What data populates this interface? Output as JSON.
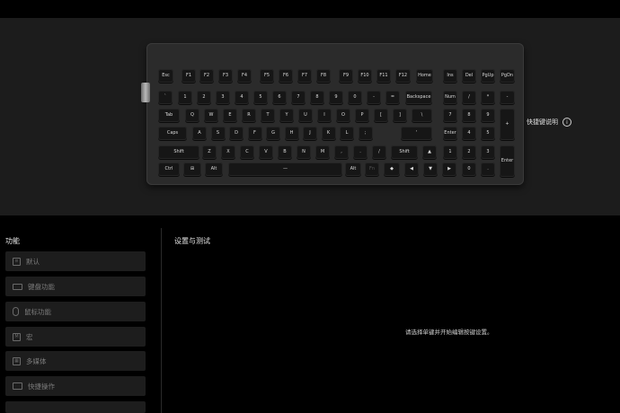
{
  "keyboard": {
    "rows": [
      [
        {
          "id": "esc",
          "label": "Esc"
        },
        {
          "id": "f1",
          "label": "F1"
        },
        {
          "id": "f2",
          "label": "F2"
        },
        {
          "id": "f3",
          "label": "F3"
        },
        {
          "id": "f4",
          "label": "F4"
        },
        {
          "id": "f5",
          "label": "F5"
        },
        {
          "id": "f6",
          "label": "F6"
        },
        {
          "id": "f7",
          "label": "F7"
        },
        {
          "id": "f8",
          "label": "F8"
        },
        {
          "id": "f9",
          "label": "F9"
        },
        {
          "id": "f10",
          "label": "F10"
        },
        {
          "id": "f11",
          "label": "F11"
        },
        {
          "id": "f12",
          "label": "F12"
        },
        {
          "id": "home",
          "label": "Home"
        },
        {
          "id": "ins",
          "label": "Ins"
        },
        {
          "id": "del",
          "label": "Del"
        },
        {
          "id": "pgup",
          "label": "PgUp"
        },
        {
          "id": "pgdn",
          "label": "PgDn"
        }
      ],
      [
        {
          "id": "grave",
          "label": "`"
        },
        {
          "id": "1",
          "label": "1"
        },
        {
          "id": "2",
          "label": "2"
        },
        {
          "id": "3",
          "label": "3"
        },
        {
          "id": "4",
          "label": "4"
        },
        {
          "id": "5",
          "label": "5"
        },
        {
          "id": "6",
          "label": "6"
        },
        {
          "id": "7",
          "label": "7"
        },
        {
          "id": "8",
          "label": "8"
        },
        {
          "id": "9",
          "label": "9"
        },
        {
          "id": "0",
          "label": "0"
        },
        {
          "id": "minus",
          "label": "-"
        },
        {
          "id": "equal",
          "label": "="
        },
        {
          "id": "backspace",
          "label": "Backspace"
        },
        {
          "id": "num",
          "label": "Num"
        },
        {
          "id": "np-slash",
          "label": "/"
        },
        {
          "id": "np-star",
          "label": "*"
        },
        {
          "id": "np-minus",
          "label": "-"
        }
      ],
      [
        {
          "id": "tab",
          "label": "Tab"
        },
        {
          "id": "q",
          "label": "Q"
        },
        {
          "id": "w",
          "label": "W"
        },
        {
          "id": "e",
          "label": "E"
        },
        {
          "id": "r",
          "label": "R"
        },
        {
          "id": "t",
          "label": "T"
        },
        {
          "id": "y",
          "label": "Y"
        },
        {
          "id": "u",
          "label": "U"
        },
        {
          "id": "i",
          "label": "I"
        },
        {
          "id": "o",
          "label": "O"
        },
        {
          "id": "p",
          "label": "P"
        },
        {
          "id": "lbracket",
          "label": "["
        },
        {
          "id": "rbracket",
          "label": "]"
        },
        {
          "id": "backslash",
          "label": "\\"
        },
        {
          "id": "np7",
          "label": "7"
        },
        {
          "id": "np8",
          "label": "8"
        },
        {
          "id": "np9",
          "label": "9"
        },
        {
          "id": "np-plus",
          "label": "+"
        }
      ],
      [
        {
          "id": "caps",
          "label": "Caps"
        },
        {
          "id": "a",
          "label": "A"
        },
        {
          "id": "s",
          "label": "S"
        },
        {
          "id": "d",
          "label": "D"
        },
        {
          "id": "f",
          "label": "F"
        },
        {
          "id": "g",
          "label": "G"
        },
        {
          "id": "h",
          "label": "H"
        },
        {
          "id": "j",
          "label": "J"
        },
        {
          "id": "k",
          "label": "K"
        },
        {
          "id": "l",
          "label": "L"
        },
        {
          "id": "semicolon",
          "label": ";"
        },
        {
          "id": "quote",
          "label": "'"
        },
        {
          "id": "enter",
          "label": "Enter"
        },
        {
          "id": "np4",
          "label": "4"
        },
        {
          "id": "np5",
          "label": "5"
        },
        {
          "id": "np6",
          "label": "6"
        }
      ],
      [
        {
          "id": "lshift",
          "label": "Shift"
        },
        {
          "id": "z",
          "label": "Z"
        },
        {
          "id": "x",
          "label": "X"
        },
        {
          "id": "c",
          "label": "C"
        },
        {
          "id": "v",
          "label": "V"
        },
        {
          "id": "b",
          "label": "B"
        },
        {
          "id": "n",
          "label": "N"
        },
        {
          "id": "m",
          "label": "M"
        },
        {
          "id": "comma",
          "label": ","
        },
        {
          "id": "period",
          "label": "."
        },
        {
          "id": "slash",
          "label": "/"
        },
        {
          "id": "rshift",
          "label": "Shift"
        },
        {
          "id": "up",
          "label": "▲"
        },
        {
          "id": "np1",
          "label": "1"
        },
        {
          "id": "np2",
          "label": "2"
        },
        {
          "id": "np3",
          "label": "3"
        },
        {
          "id": "np-enter",
          "label": "Enter"
        }
      ],
      [
        {
          "id": "ctrl",
          "label": "Ctrl"
        },
        {
          "id": "win",
          "label": "⊞"
        },
        {
          "id": "lalt",
          "label": "Alt"
        },
        {
          "id": "space",
          "label": "—"
        },
        {
          "id": "ralt",
          "label": "Alt"
        },
        {
          "id": "fn",
          "label": "Fn"
        },
        {
          "id": "menu",
          "label": "◆"
        },
        {
          "id": "left",
          "label": "◀"
        },
        {
          "id": "down",
          "label": "▼"
        },
        {
          "id": "right",
          "label": "▶"
        },
        {
          "id": "np0",
          "label": "0"
        },
        {
          "id": "np-dot",
          "label": "."
        }
      ]
    ]
  },
  "shortcut_hint": {
    "label": "快捷键说明",
    "icon": "info-icon"
  },
  "left_panel": {
    "title": "功能",
    "items": [
      {
        "label": "默认",
        "icon": "document-icon"
      },
      {
        "label": "键盘功能",
        "icon": "keyboard-icon"
      },
      {
        "label": "鼠标功能",
        "icon": "mouse-icon"
      },
      {
        "label": "宏",
        "icon": "macro-icon"
      },
      {
        "label": "多媒体",
        "icon": "media-grid-icon"
      },
      {
        "label": "快捷操作",
        "icon": "shortcut-icon"
      }
    ]
  },
  "right_panel": {
    "title": "设置与测试",
    "empty_message": "请选择单键并开始编辑按键设置。"
  }
}
